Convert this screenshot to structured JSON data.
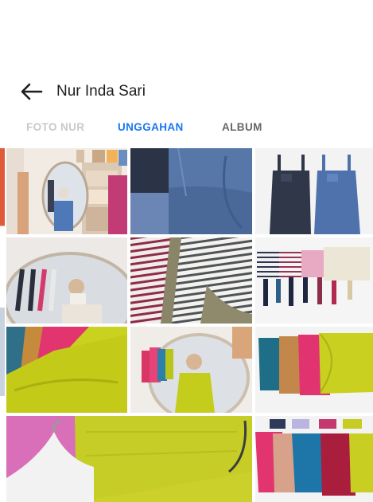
{
  "header": {
    "title": "Nur Inda Sari",
    "back_icon": "arrow-left-icon"
  },
  "tabs": [
    {
      "label": "FOTO NUR",
      "state": "inactive"
    },
    {
      "label": "UNGGAHAN",
      "state": "active"
    },
    {
      "label": "ALBUM",
      "state": "inactive"
    }
  ],
  "colors": {
    "active_tab": "#1877f2",
    "inactive_tab": "#65676b",
    "faded_tab": "#c7c9cc"
  }
}
